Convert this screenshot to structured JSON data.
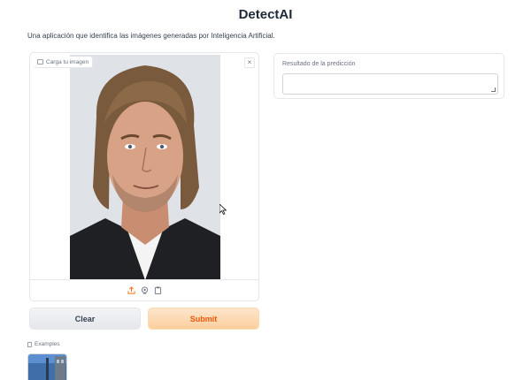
{
  "app": {
    "title": "DetectAI",
    "description": "Una aplicación que identifica las imágenes generadas por Inteligencia Artificial."
  },
  "image_input": {
    "label": "Carga tu imagen",
    "close_symbol": "×",
    "label_icon": "image-icon",
    "tools": [
      "upload-icon",
      "webcam-icon",
      "clipboard-icon"
    ]
  },
  "buttons": {
    "clear": "Clear",
    "submit": "Submit"
  },
  "examples": {
    "label": "Examples",
    "icon": "table-icon"
  },
  "output": {
    "label": "Resultado de la predicción",
    "value": ""
  },
  "colors": {
    "submit_text": "#ea580c",
    "submit_bg": "#fbcf9c",
    "clear_bg": "#e5e7eb",
    "border": "#e5e7eb"
  }
}
